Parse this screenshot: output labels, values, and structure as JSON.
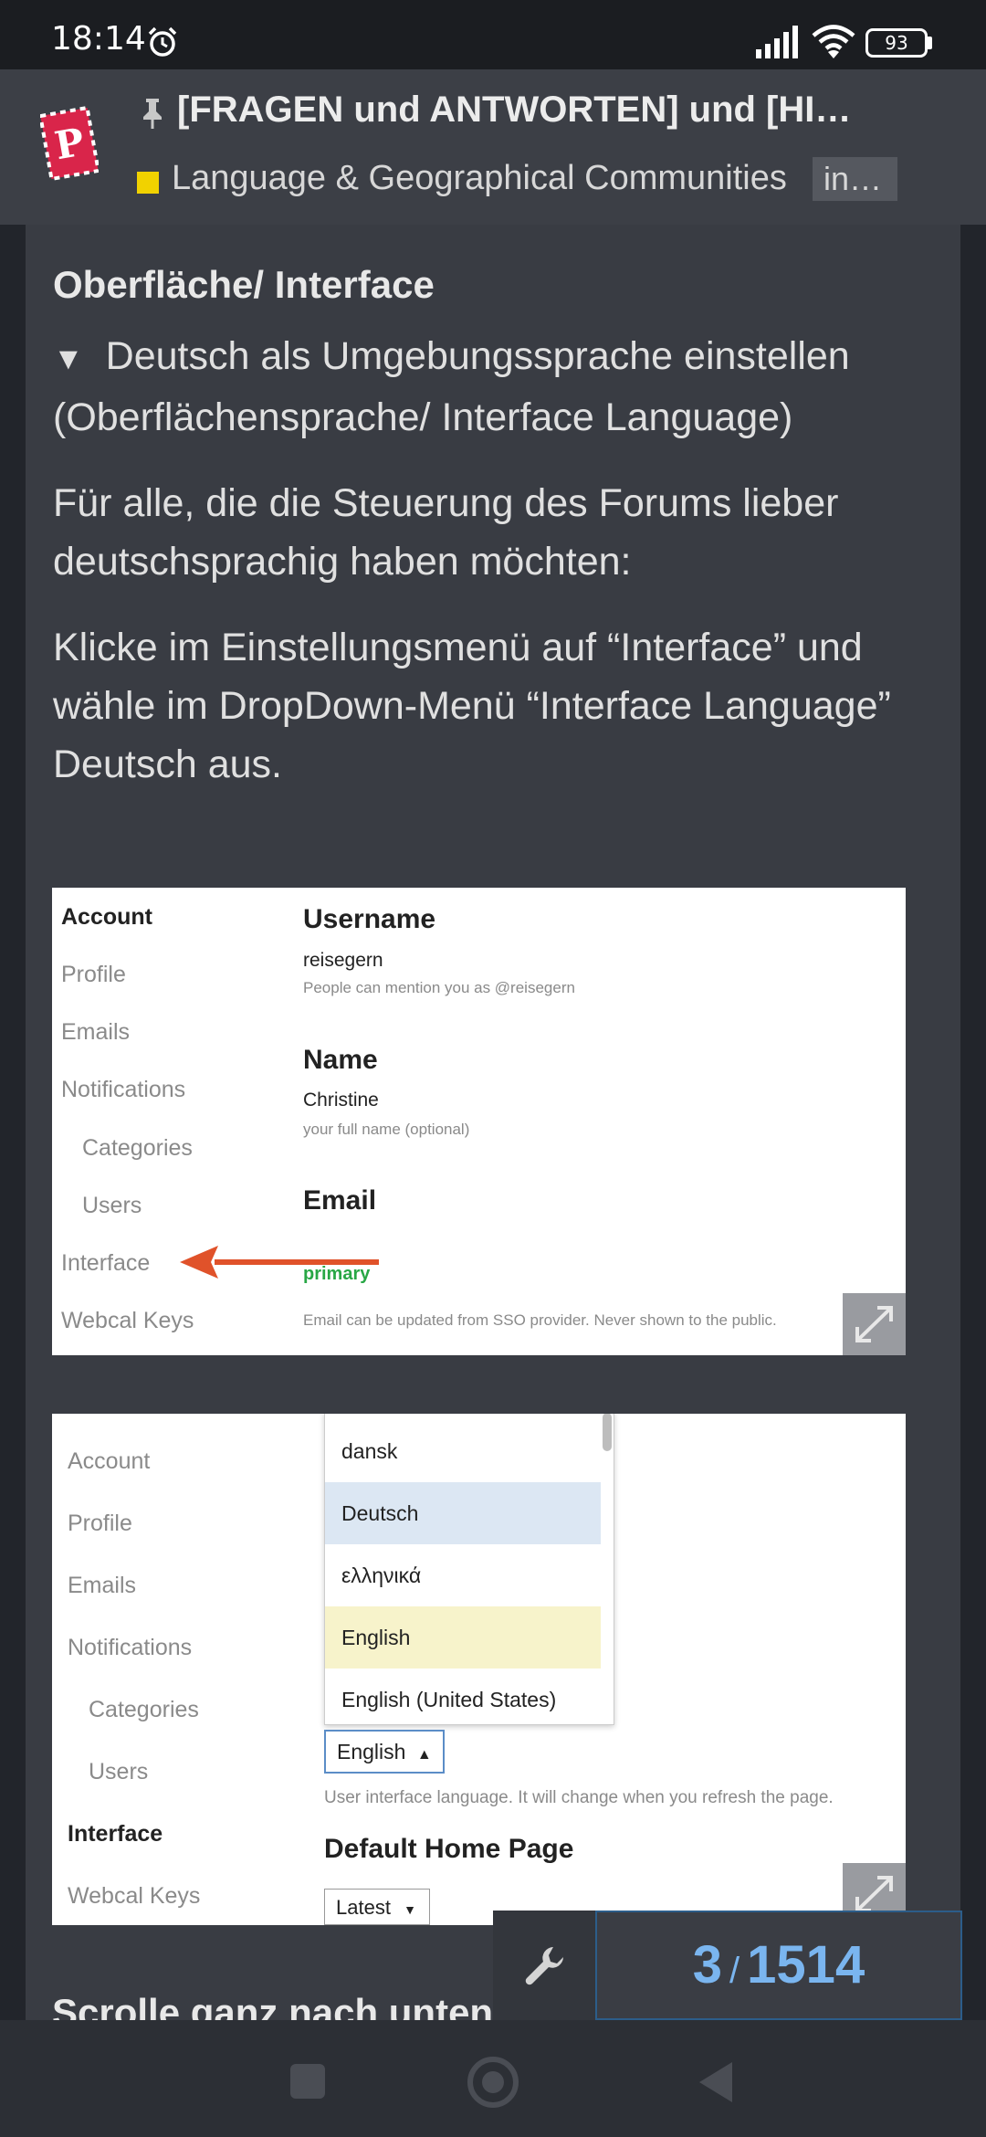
{
  "status_bar": {
    "time": "18:14",
    "battery": "93"
  },
  "header": {
    "title": "[FRAGEN und ANTWORTEN] und [HI…",
    "category": "Language & Geographical Communities",
    "category_tag": "in…",
    "colors": {
      "category_swatch": "#f1d200",
      "logo": "#d9254a"
    }
  },
  "post": {
    "heading": "Oberfläche/ Interface",
    "details_summary": "Deutsch als Umgebungssprache einstellen (Oberflächensprache/ Interface Language)",
    "para1": "Für alle, die die Steuerung des Forums lieber deutschsprachig haben möchten:",
    "para2": "Klicke im Einstellungsmenü auf “Interface” und wähle im DropDown-Menü “Interface Language” Deutsch aus.",
    "next_heading": "Scrolle ganz nach unten"
  },
  "screenshot1": {
    "sidebar": [
      "Account",
      "Profile",
      "Emails",
      "Notifications",
      "Categories",
      "Users",
      "Interface",
      "Webcal Keys"
    ],
    "username_label": "Username",
    "username_value": "reisegern",
    "username_hint": "People can mention you as @reisegern",
    "name_label": "Name",
    "name_value": "Christine",
    "name_hint": "your full name (optional)",
    "email_label": "Email",
    "email_badge": "primary",
    "email_hint": "Email can be updated from SSO provider. Never shown to the public."
  },
  "screenshot2": {
    "sidebar": [
      "Account",
      "Profile",
      "Emails",
      "Notifications",
      "Categories",
      "Users",
      "Interface",
      "Webcal Keys"
    ],
    "dropdown_options": [
      "dansk",
      "Deutsch",
      "ελληνικά",
      "English",
      "English (United States)"
    ],
    "selected_language": "English",
    "language_hint": "User interface language. It will change when you refresh the page.",
    "home_label": "Default Home Page",
    "home_value": "Latest"
  },
  "progress": {
    "current": "3",
    "total": "1514"
  }
}
